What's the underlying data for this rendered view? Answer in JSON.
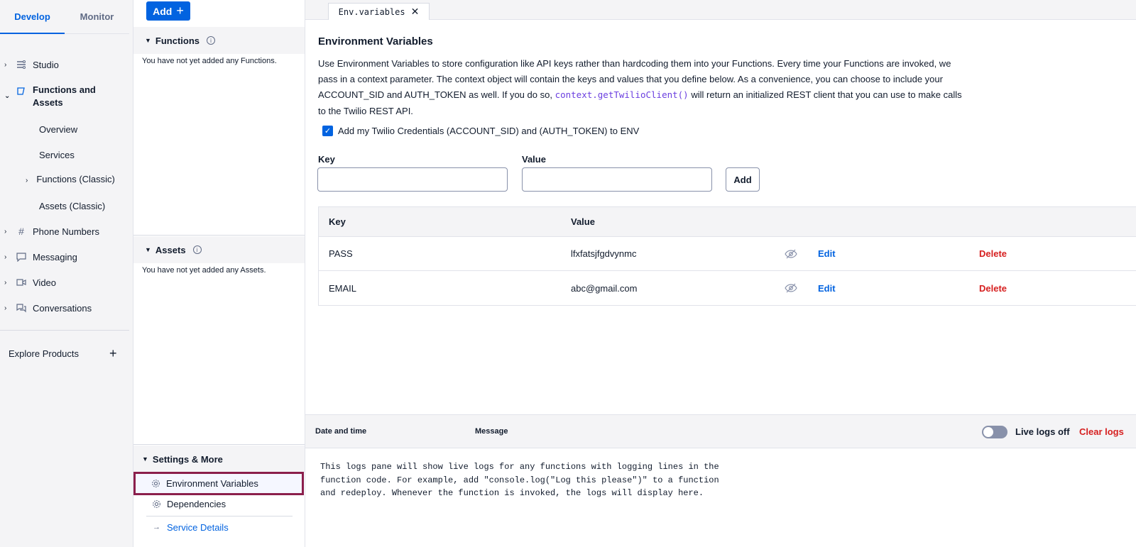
{
  "left_nav": {
    "tabs": [
      {
        "label": "Develop"
      },
      {
        "label": "Monitor"
      }
    ],
    "items": [
      {
        "label": "Studio"
      },
      {
        "label": "Functions and Assets"
      },
      {
        "label": "Phone Numbers"
      },
      {
        "label": "Messaging"
      },
      {
        "label": "Video"
      },
      {
        "label": "Conversations"
      }
    ],
    "sub_items": [
      {
        "label": "Overview"
      },
      {
        "label": "Services"
      },
      {
        "label": "Functions (Classic)"
      },
      {
        "label": "Assets (Classic)"
      }
    ],
    "explore_label": "Explore Products"
  },
  "mid_panel": {
    "add_label": "Add",
    "functions": {
      "title": "Functions",
      "empty_text": "You have not yet added any Functions."
    },
    "assets": {
      "title": "Assets",
      "empty_text": "You have not yet added any Assets."
    },
    "settings": {
      "title": "Settings & More",
      "items": [
        {
          "label": "Environment Variables"
        },
        {
          "label": "Dependencies"
        },
        {
          "label": "Service Details"
        }
      ]
    }
  },
  "editor_tab": {
    "label": "Env.variables"
  },
  "env": {
    "title": "Environment Variables",
    "desc_part1": "Use Environment Variables to store configuration like API keys rather than hardcoding them into your Functions. Every time your Functions are invoked, we pass in a context parameter. The context object will contain the keys and values that you define below. As a convenience, you can choose to include your ACCOUNT_SID and AUTH_TOKEN as well. If you do so,",
    "desc_code": "context.getTwilioClient()",
    "desc_part2": "will return an initialized REST client that you can use to make calls to the Twilio REST API.",
    "checkbox_label": "Add my Twilio Credentials (ACCOUNT_SID) and (AUTH_TOKEN) to ENV",
    "key_label": "Key",
    "value_label": "Value",
    "add_label": "Add",
    "table": {
      "headers": {
        "key": "Key",
        "value": "Value"
      },
      "rows": [
        {
          "key": "PASS",
          "value": "lfxfatsjfgdvynmc",
          "edit": "Edit",
          "delete": "Delete"
        },
        {
          "key": "EMAIL",
          "value": "abc@gmail.com",
          "edit": "Edit",
          "delete": "Delete"
        }
      ]
    }
  },
  "logs": {
    "date_header": "Date and time",
    "message_header": "Message",
    "live_label": "Live logs off",
    "clear_label": "Clear logs",
    "body_text": "This logs pane will show live logs for any functions with logging lines in the\nfunction code. For example, add \"console.log(\"Log this please\")\" to a function\nand redeploy. Whenever the function is invoked, the logs will display here."
  },
  "colors": {
    "accent": "#0263e0",
    "danger": "#d61f1f",
    "highlight_border": "#8b1f4c"
  }
}
